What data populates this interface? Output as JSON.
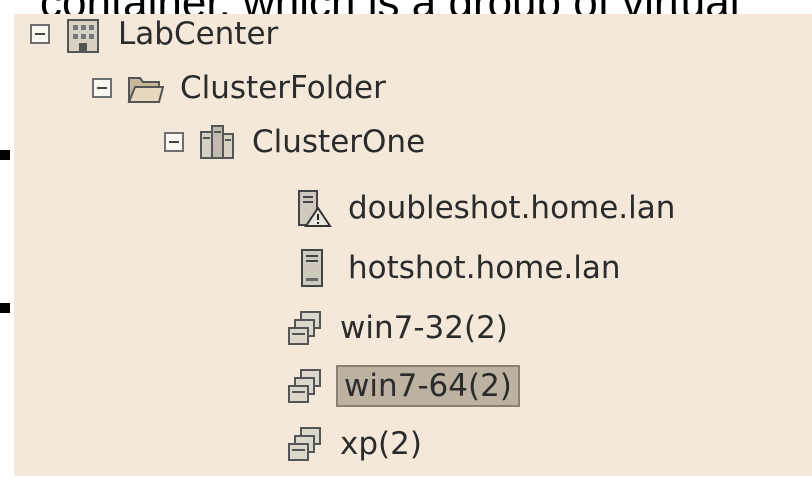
{
  "background": {
    "overlay_text": "container, which is a group of virtual"
  },
  "tree": {
    "nodes": [
      {
        "label": "LabCenter",
        "icon": "datacenter-icon",
        "expanded": true,
        "depth": 0
      },
      {
        "label": "ClusterFolder",
        "icon": "folder-icon",
        "expanded": true,
        "depth": 1
      },
      {
        "label": "ClusterOne",
        "icon": "cluster-icon",
        "expanded": true,
        "depth": 2
      },
      {
        "label": "doubleshot.home.lan",
        "icon": "host-warning-icon",
        "depth": 3
      },
      {
        "label": "hotshot.home.lan",
        "icon": "host-icon",
        "depth": 3
      },
      {
        "label": "win7-32(2)",
        "icon": "vapp-icon",
        "depth": 3
      },
      {
        "label": "win7-64(2)",
        "icon": "vapp-icon",
        "depth": 3,
        "selected": true
      },
      {
        "label": "xp(2)",
        "icon": "vapp-icon",
        "depth": 3
      }
    ]
  },
  "colors": {
    "panel_background": "#f3e8da",
    "selection": "#bdb1a2",
    "text": "#2b2b2b"
  }
}
